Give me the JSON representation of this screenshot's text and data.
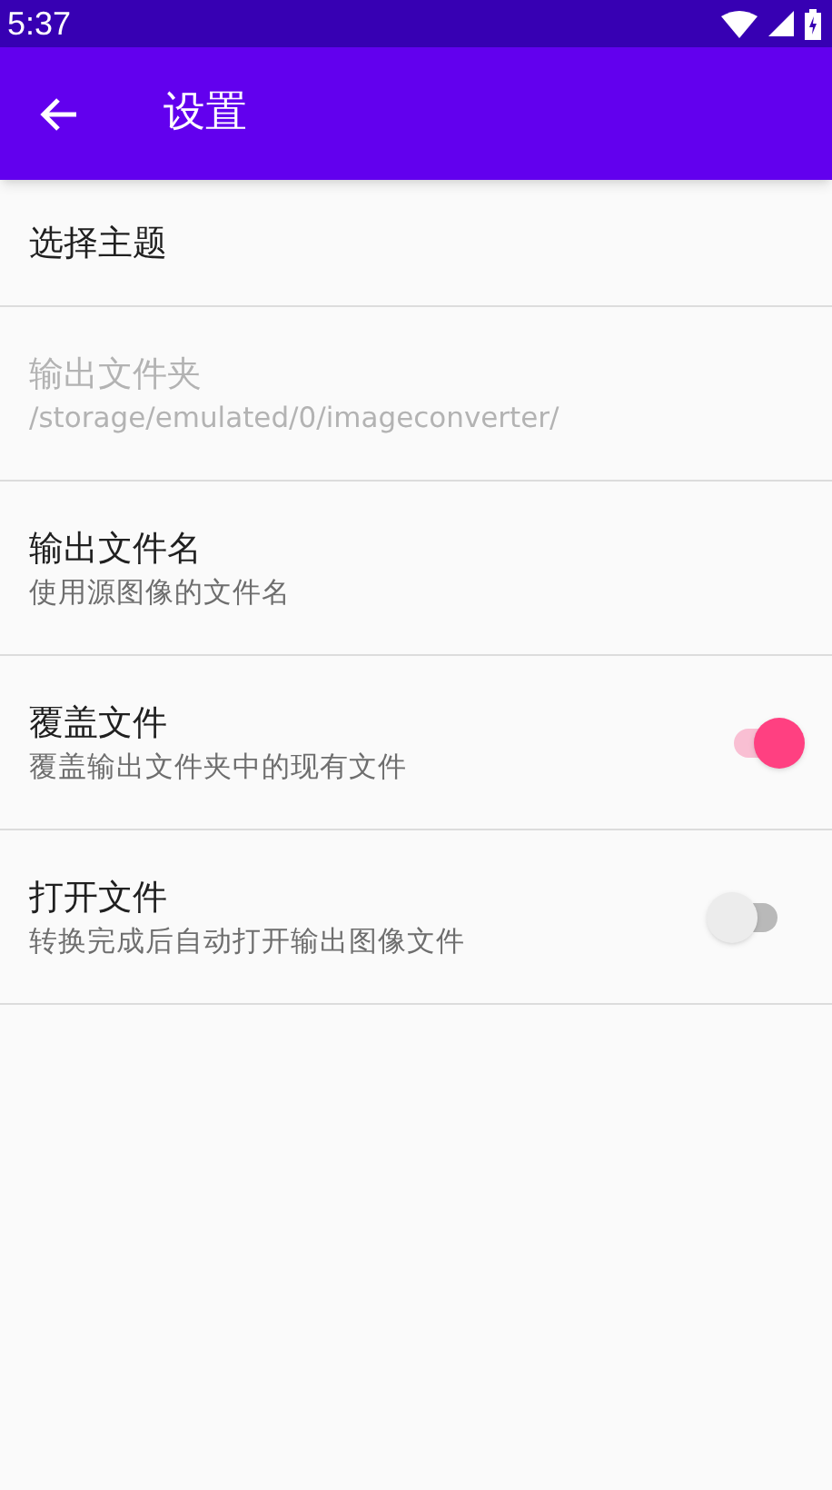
{
  "status_bar": {
    "time": "5:37"
  },
  "app_bar": {
    "title": "设置"
  },
  "settings": [
    {
      "kind": "text",
      "title": "选择主题",
      "disabled": false
    },
    {
      "kind": "text",
      "title": "输出文件夹",
      "subtitle": "/storage/emulated/0/imageconverter/",
      "disabled": true
    },
    {
      "kind": "text",
      "title": "输出文件名",
      "subtitle": "使用源图像的文件名",
      "disabled": false
    },
    {
      "kind": "switch",
      "title": "覆盖文件",
      "subtitle": "覆盖输出文件夹中的现有文件",
      "disabled": false,
      "on": true
    },
    {
      "kind": "switch",
      "title": "打开文件",
      "subtitle": "转换完成后自动打开输出图像文件",
      "disabled": false,
      "on": false
    }
  ]
}
